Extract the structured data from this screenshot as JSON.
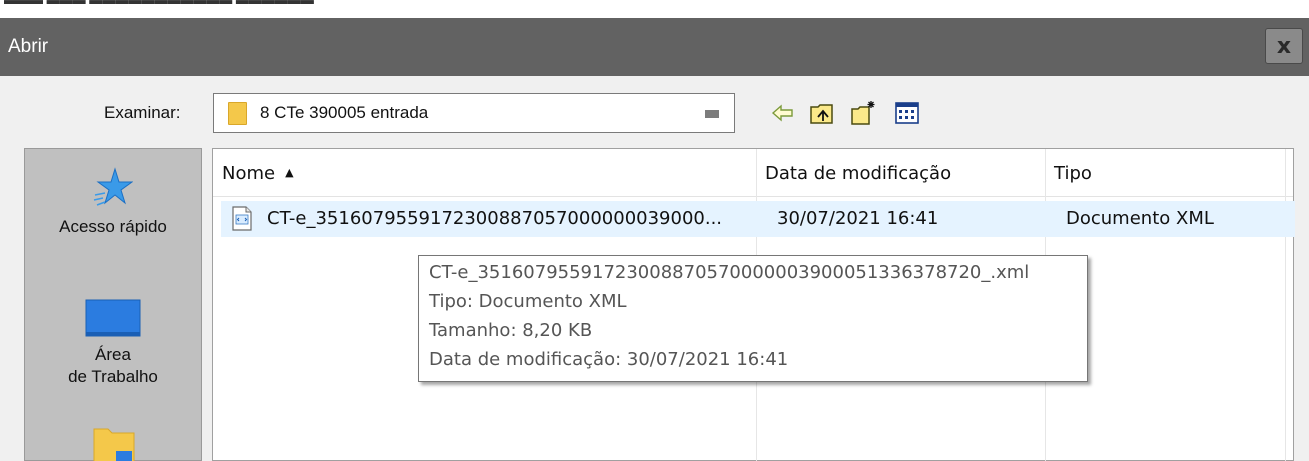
{
  "window": {
    "title": "Abrir",
    "close_symbol": "x"
  },
  "lookin": {
    "label": "Examinar:",
    "value": "8 CTe 390005 entrada"
  },
  "toolbar": [
    {
      "name": "back-icon"
    },
    {
      "name": "up-folder-icon"
    },
    {
      "name": "new-folder-icon"
    },
    {
      "name": "view-menu-icon"
    }
  ],
  "places": [
    {
      "label": "Acesso rápido",
      "icon": "star-icon"
    },
    {
      "label_line1": "Área",
      "label_line2": "de Trabalho",
      "icon": "desktop-icon"
    },
    {
      "icon": "folder-icon"
    }
  ],
  "columns": [
    {
      "label": "Nome",
      "sort": "ascending"
    },
    {
      "label": "Data de modificação"
    },
    {
      "label": "Tipo"
    }
  ],
  "files": [
    {
      "name": "CT-e_3516079559172300887057000000039000...",
      "modified": "30/07/2021 16:41",
      "type": "Documento XML",
      "icon": "xml-file-icon"
    }
  ],
  "tooltip": {
    "filename": "CT-e_35160795591723008870570000003900051336378720_.xml",
    "type_line": "Tipo: Documento XML",
    "size_line": "Tamanho: 8,20 KB",
    "date_line": "Data de modificação: 30/07/2021 16:41"
  },
  "colors": {
    "titlebar": "#626262",
    "places_bg": "#c0c0c0",
    "selection": "#e5f3ff",
    "folder": "#f4c84a",
    "accent_blue": "#2b7ce0"
  }
}
